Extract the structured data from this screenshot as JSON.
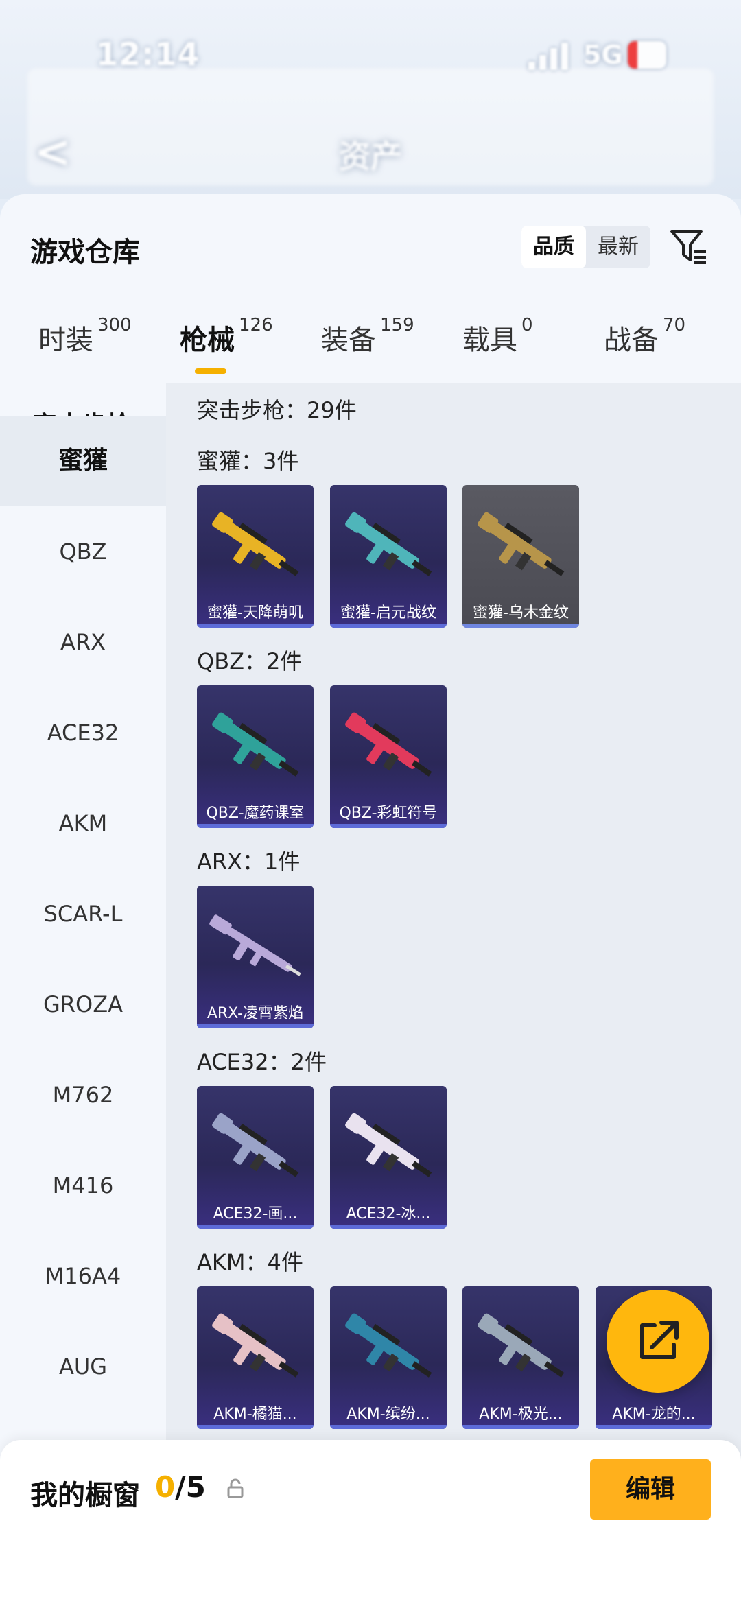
{
  "status_bar": {
    "time": "12:14",
    "network": "5G"
  },
  "nav": {
    "back_icon": "chevron-left-icon",
    "title": "资产"
  },
  "warehouse": {
    "title": "游戏仓库",
    "sort": {
      "options": [
        "品质",
        "最新"
      ],
      "selected": "品质"
    },
    "filter_icon": "filter-icon"
  },
  "tabs": [
    {
      "label": "时装",
      "count": "300",
      "active": false
    },
    {
      "label": "枪械",
      "count": "126",
      "active": true
    },
    {
      "label": "装备",
      "count": "159",
      "active": false
    },
    {
      "label": "载具",
      "count": "0",
      "active": false
    },
    {
      "label": "战备",
      "count": "70",
      "active": false
    }
  ],
  "sidebar": {
    "group": "突击步枪",
    "items": [
      "蜜獾",
      "QBZ",
      "ARX",
      "ACE32",
      "AKM",
      "SCAR-L",
      "GROZA",
      "M762",
      "M416",
      "M16A4",
      "AUG"
    ],
    "active": "蜜獾"
  },
  "main": {
    "summary": "突击步枪：29件",
    "sections": [
      {
        "title": "蜜獾：3件",
        "items": [
          "蜜獾-天降萌叽",
          "蜜獾-启元战纹",
          "蜜獾-乌木金纹"
        ]
      },
      {
        "title": "QBZ：2件",
        "items": [
          "QBZ-魔药课室",
          "QBZ-彩虹符号"
        ]
      },
      {
        "title": "ARX：1件",
        "items": [
          "ARX-凌霄紫焰"
        ]
      },
      {
        "title": "ACE32：2件",
        "items": [
          "ACE32-画...",
          "ACE32-冰..."
        ]
      },
      {
        "title": "AKM：4件",
        "items": [
          "AKM-橘猫...",
          "AKM-缤纷...",
          "AKM-极光...",
          "AKM-龙的..."
        ]
      }
    ]
  },
  "share_button": {
    "icon": "share-icon"
  },
  "showcase": {
    "label": "我的橱窗",
    "current": "0",
    "total": "/5",
    "lock_icon": "lock-icon",
    "edit_label": "编辑"
  },
  "colors": {
    "accent": "#f5b000",
    "card": "#2f2c62"
  }
}
